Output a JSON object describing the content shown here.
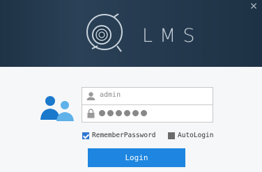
{
  "window": {
    "close_glyph": "×"
  },
  "header": {
    "brand": "LMS",
    "logo_icon": "webcam-logo-icon"
  },
  "login": {
    "username_value": "admin",
    "password_masked_count": 6,
    "remember": {
      "label": "RememberPassword",
      "checked": true
    },
    "auto_login": {
      "label": "AutoLogin",
      "checked": false
    },
    "submit_label": "Login"
  },
  "colors": {
    "header_bg": "#263b50",
    "accent": "#1e86e0",
    "body_bg": "#f6f7f9"
  }
}
